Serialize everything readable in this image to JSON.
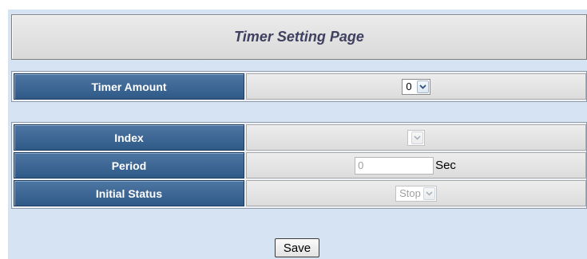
{
  "page": {
    "title": "Timer Setting Page"
  },
  "timer_amount": {
    "label": "Timer Amount",
    "value": "0"
  },
  "settings": {
    "index_label": "Index",
    "index_value": "",
    "period_label": "Period",
    "period_placeholder": "0",
    "period_unit": "Sec",
    "initial_status_label": "Initial Status",
    "initial_status_value": "Stop"
  },
  "actions": {
    "save_label": "Save"
  },
  "colors": {
    "page_background": "#d5e3f2",
    "label_cell": "#3d6894",
    "value_cell": "#e4e4e4",
    "title_text": "#404060"
  }
}
